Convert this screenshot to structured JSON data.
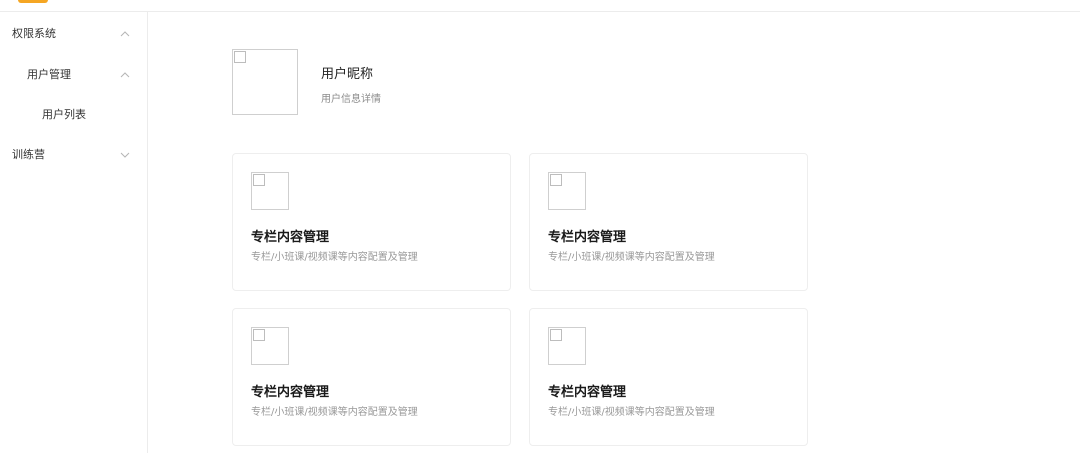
{
  "sidebar": {
    "items": [
      {
        "label": "权限系统",
        "icon": "chevron-up-icon"
      },
      {
        "label": "用户管理",
        "icon": "chevron-up-icon"
      },
      {
        "label": "用户列表"
      },
      {
        "label": "训练营",
        "icon": "chevron-down-icon"
      }
    ]
  },
  "profile": {
    "name": "用户昵称",
    "subtitle": "用户信息详情",
    "avatar_icon": "image-placeholder-icon"
  },
  "cards": [
    {
      "title": "专栏内容管理",
      "desc": "专栏/小班课/视频课等内容配置及管理",
      "icon": "image-placeholder-icon"
    },
    {
      "title": "专栏内容管理",
      "desc": "专栏/小班课/视频课等内容配置及管理",
      "icon": "image-placeholder-icon"
    },
    {
      "title": "专栏内容管理",
      "desc": "专栏/小班课/视频课等内容配置及管理",
      "icon": "image-placeholder-icon"
    },
    {
      "title": "专栏内容管理",
      "desc": "专栏/小班课/视频课等内容配置及管理",
      "icon": "image-placeholder-icon"
    }
  ],
  "colors": {
    "brand": "#f5a623",
    "border": "#ececec",
    "text_primary": "#222222",
    "text_secondary": "#999999"
  }
}
